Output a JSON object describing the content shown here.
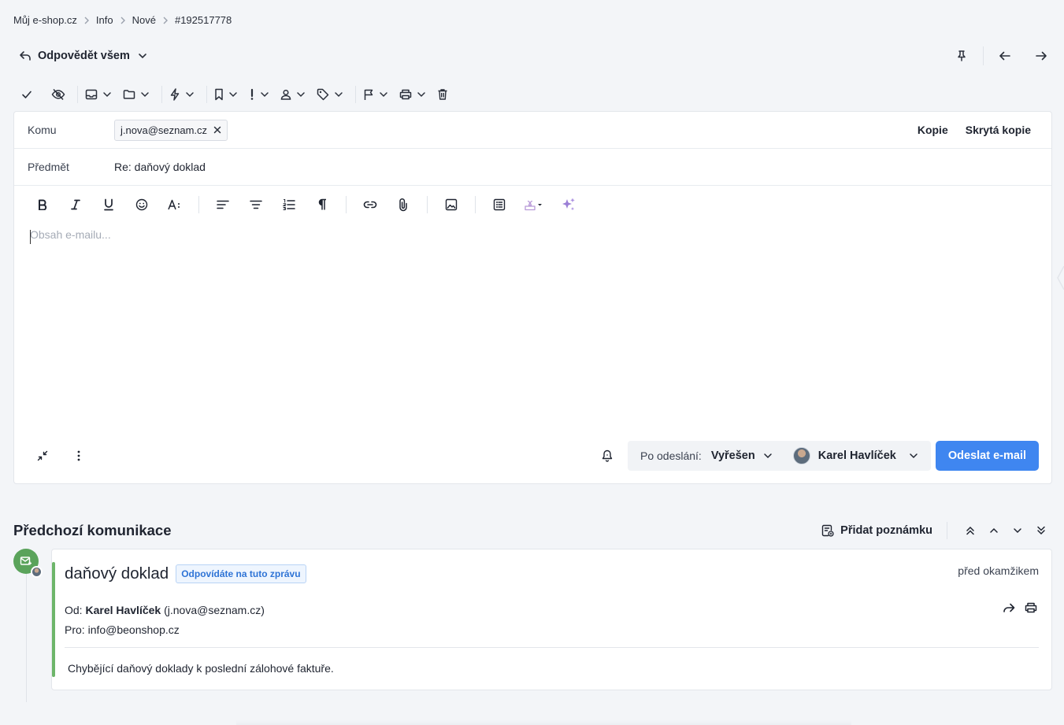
{
  "breadcrumb": [
    "Můj e-shop.cz",
    "Info",
    "Nové",
    "#192517778"
  ],
  "reply": {
    "label": "Odpovědět všem"
  },
  "composer": {
    "to_label": "Komu",
    "to_chip": "j.nova@seznam.cz",
    "cc_label": "Kopie",
    "bcc_label": "Skrytá kopie",
    "subject_label": "Předmět",
    "subject_value": "Re: daňový doklad",
    "body_placeholder": "Obsah e-mailu...",
    "after_send_label": "Po odeslání:",
    "after_send_value": "Vyřešen",
    "agent_name": "Karel Havlíček",
    "send_label": "Odeslat e-mail"
  },
  "previous": {
    "title": "Předchozí komunikace",
    "add_note_label": "Přidat poznámku",
    "message": {
      "subject": "daňový doklad",
      "badge": "Odpovídáte na tuto zprávu",
      "time": "před okamžikem",
      "from_prefix": "Od:",
      "from_name": "Karel Havlíček",
      "from_email": "(j.nova@seznam.cz)",
      "to_prefix": "Pro:",
      "to_email": "info@beonshop.cz",
      "body": "Chybějící daňový doklady k poslední zálohové faktuře."
    }
  },
  "colors": {
    "accent_blue": "#3f86f0",
    "thread_green": "#6db56a",
    "badge_blue": "#2f74d6"
  }
}
